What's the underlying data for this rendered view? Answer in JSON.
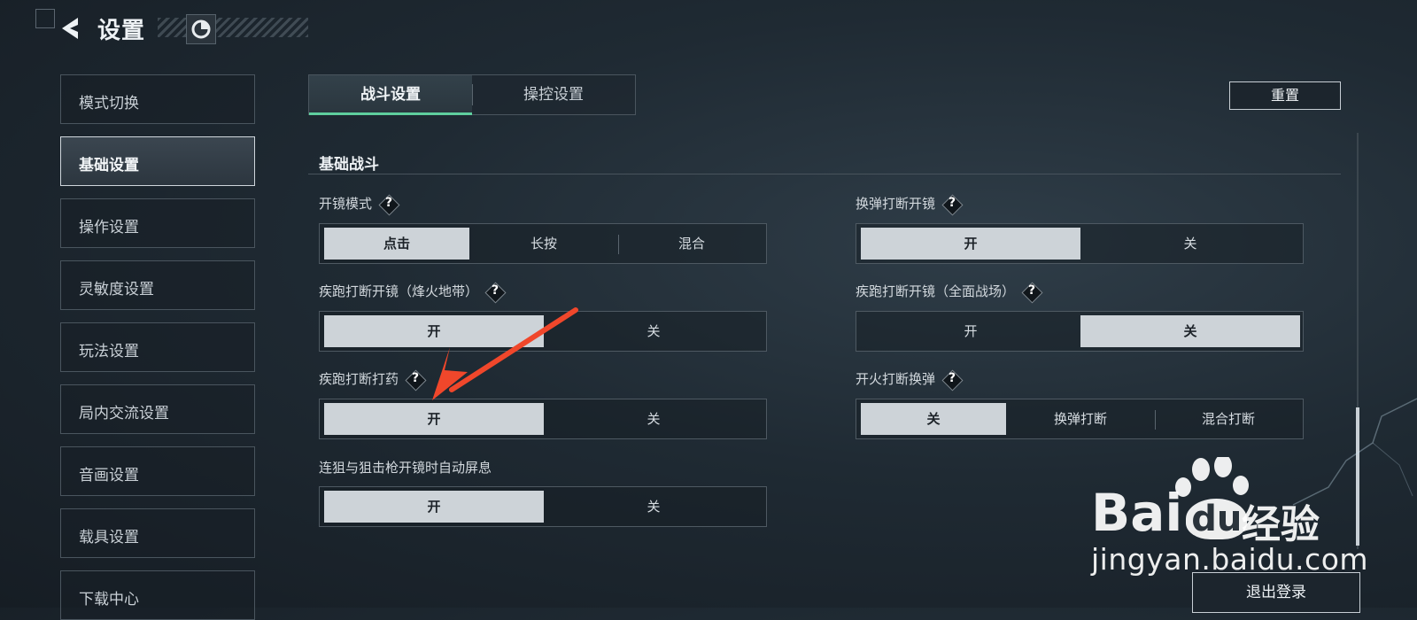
{
  "header": {
    "title": "设置",
    "back_icon": "back-arrow-icon",
    "profile_icon": "ring-icon"
  },
  "sidebar": {
    "items": [
      {
        "label": "模式切换",
        "active": false
      },
      {
        "label": "基础设置",
        "active": true
      },
      {
        "label": "操作设置",
        "active": false
      },
      {
        "label": "灵敏度设置",
        "active": false
      },
      {
        "label": "玩法设置",
        "active": false
      },
      {
        "label": "局内交流设置",
        "active": false
      },
      {
        "label": "音画设置",
        "active": false
      },
      {
        "label": "载具设置",
        "active": false
      },
      {
        "label": "下载中心",
        "active": false
      }
    ]
  },
  "tabs": [
    {
      "label": "战斗设置",
      "active": true
    },
    {
      "label": "操控设置",
      "active": false
    }
  ],
  "reset_label": "重置",
  "section": {
    "title": "基础战斗"
  },
  "settings": [
    {
      "label": "开镜模式",
      "help": "?",
      "options": [
        "点击",
        "长按",
        "混合"
      ],
      "selected": "点击"
    },
    {
      "label": "换弹打断开镜",
      "help": "?",
      "options": [
        "开",
        "关"
      ],
      "selected": "开"
    },
    {
      "label": "疾跑打断开镜（烽火地带）",
      "help": "?",
      "options": [
        "开",
        "关"
      ],
      "selected": "开"
    },
    {
      "label": "疾跑打断开镜（全面战场）",
      "help": "?",
      "options": [
        "开",
        "关"
      ],
      "selected": "关"
    },
    {
      "label": "疾跑打断打药",
      "help": "?",
      "options": [
        "开",
        "关"
      ],
      "selected": "开"
    },
    {
      "label": "开火打断换弹",
      "help": "?",
      "options": [
        "关",
        "换弹打断",
        "混合打断"
      ],
      "selected": "关"
    },
    {
      "label": "连狙与狙击枪开镜时自动屏息",
      "options": [
        "开",
        "关"
      ],
      "selected": "开"
    }
  ],
  "logout_label": "退出登录",
  "watermark": {
    "brand": "Bai",
    "brand_du": "du",
    "suffix": "经验",
    "url": "jingyan.baidu.com"
  },
  "colors": {
    "accent": "#5fcf9e",
    "selected": "#cdd3d8",
    "arrow": "#f0472b"
  }
}
